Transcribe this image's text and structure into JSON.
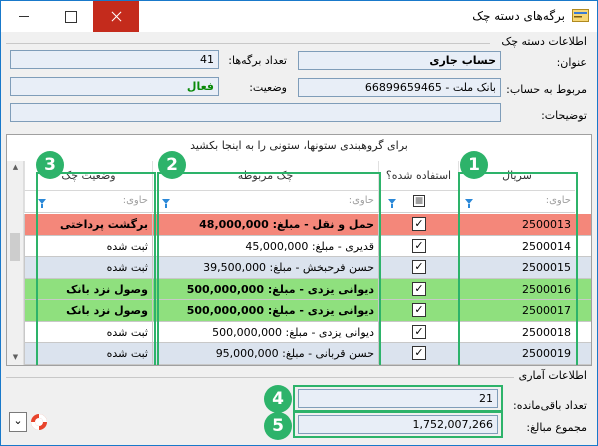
{
  "window": {
    "title": "برگه‌های دسته چک",
    "minimize": "—",
    "maximize": "☐",
    "close": "✕"
  },
  "info_section": {
    "title": "اطلاعات دسته چک",
    "title_label": "عنوان:",
    "title_value": "حساب جاری",
    "sheet_count_label": "تعداد برگه‌ها:",
    "sheet_count_value": "41",
    "account_label": "مربوط به حساب:",
    "account_value": "بانک ملت - 66899659465",
    "status_label": "وضعیت:",
    "status_value": "فعال",
    "description_label": "توضیحات:",
    "description_value": ""
  },
  "grid": {
    "group_hint": "برای گروهبندی ستونها، ستونی را به اینجا بکشید",
    "columns": {
      "serial": "سریال",
      "used": "استفاده شده؟",
      "related_check": "چک مربوطه",
      "check_status": "وضعیت چک"
    },
    "filter_placeholder": "حاوی:",
    "rows": [
      {
        "serial": "2500013",
        "used": "✓",
        "related": "حمل و نقل - مبلغ: 48,000,000",
        "status": "برگشت پرداختی",
        "bg": "#f4877a",
        "bold": true
      },
      {
        "serial": "2500014",
        "used": "✓",
        "related": "قدیری - مبلغ: 45,000,000",
        "status": "ثبت شده",
        "bg": "#ffffff",
        "bold": false
      },
      {
        "serial": "2500015",
        "used": "✓",
        "related": "حسن فرحبخش - مبلغ: 39,500,000",
        "status": "ثبت شده",
        "bg": "#dbe3ee",
        "bold": false
      },
      {
        "serial": "2500016",
        "used": "✓",
        "related": "دیوانی یزدی - مبلغ: 500,000,000",
        "status": "وصول نزد بانک",
        "bg": "#8fe07e",
        "bold": true
      },
      {
        "serial": "2500017",
        "used": "✓",
        "related": "دیوانی یزدی - مبلغ: 500,000,000",
        "status": "وصول نزد بانک",
        "bg": "#8fe07e",
        "bold": true
      },
      {
        "serial": "2500018",
        "used": "✓",
        "related": "دیوانی یزدی - مبلغ: 500,000,000",
        "status": "ثبت شده",
        "bg": "#ffffff",
        "bold": false
      },
      {
        "serial": "2500019",
        "used": "✓",
        "related": "حسن قربانی - مبلغ: 95,000,000",
        "status": "ثبت شده",
        "bg": "#dbe3ee",
        "bold": false
      }
    ],
    "badges": {
      "b1": "1",
      "b2": "2",
      "b3": "3"
    }
  },
  "stats": {
    "title": "اطلاعات آماری",
    "remaining_label": "تعداد باقی‌مانده:",
    "remaining_value": "21",
    "total_label": "مجموع مبالغ:",
    "total_value": "1,752,007,266",
    "badges": {
      "b4": "4",
      "b5": "5"
    }
  },
  "footer": {
    "dropdown_arrow": "⌄"
  },
  "colors": {
    "accent": "#2db36a",
    "negative_row": "#f4877a",
    "cashed_row": "#8fe07e",
    "alt_row": "#dbe3ee"
  }
}
